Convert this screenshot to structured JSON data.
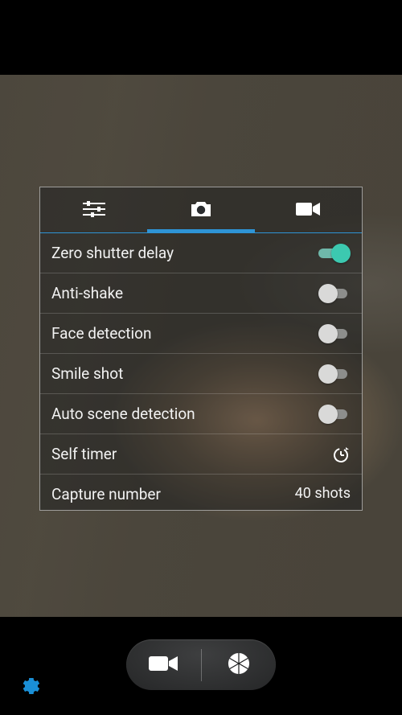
{
  "tabs": {
    "sliders": "sliders-icon",
    "photo": "camera-icon",
    "video": "video-icon",
    "active": "photo"
  },
  "settings": {
    "zero_shutter": {
      "label": "Zero shutter delay",
      "on": true
    },
    "anti_shake": {
      "label": "Anti-shake",
      "on": false
    },
    "face_detection": {
      "label": "Face detection",
      "on": false
    },
    "smile_shot": {
      "label": "Smile shot",
      "on": false
    },
    "auto_scene": {
      "label": "Auto scene detection",
      "on": false
    },
    "self_timer": {
      "label": "Self timer"
    },
    "capture_number": {
      "label": "Capture number",
      "value": "40 shots"
    }
  },
  "colors": {
    "accent_blue": "#2e94d6",
    "toggle_on": "#3cc9b0",
    "gear": "#1a8fd6"
  }
}
